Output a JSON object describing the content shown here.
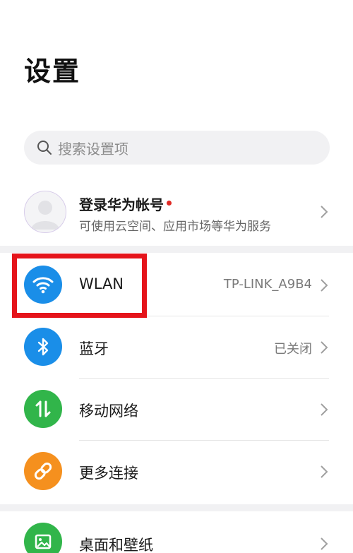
{
  "header": {
    "title": "设置"
  },
  "search": {
    "placeholder": "搜索设置项",
    "icon": "search-icon"
  },
  "account": {
    "title": "登录华为帐号",
    "subtitle": "可使用云空间、应用市场等华为服务",
    "avatar_icon": "person-avatar-icon",
    "notification_color": "#e02a25"
  },
  "items": [
    {
      "label": "WLAN",
      "value": "TP-LINK_A9B4",
      "icon": "wifi-icon",
      "color": "#1a8ee8"
    },
    {
      "label": "蓝牙",
      "value": "已关闭",
      "icon": "bluetooth-icon",
      "color": "#1a8ee8"
    },
    {
      "label": "移动网络",
      "value": "",
      "icon": "mobile-network-icon",
      "color": "#31b54a"
    },
    {
      "label": "更多连接",
      "value": "",
      "icon": "link-icon",
      "color": "#f5901e"
    },
    {
      "label": "桌面和壁纸",
      "value": "",
      "icon": "wallpaper-icon",
      "color": "#31b54a"
    }
  ],
  "annotation": {
    "highlight_color": "#e5141b"
  }
}
